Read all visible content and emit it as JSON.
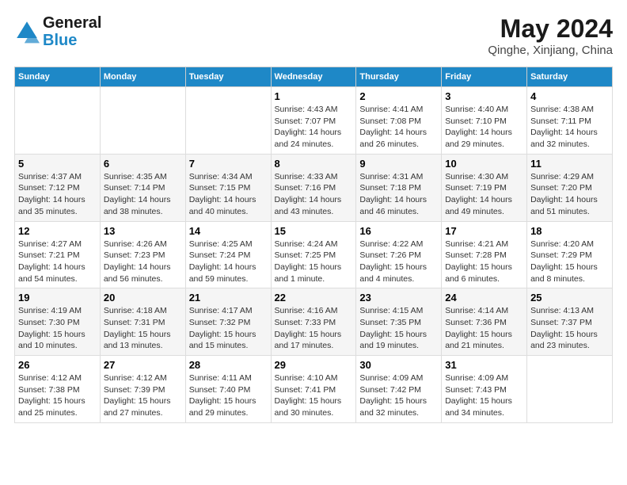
{
  "logo": {
    "line1": "General",
    "line2": "Blue",
    "icon_color": "#1e88c7"
  },
  "title": "May 2024",
  "subtitle": "Qinghe, Xinjiang, China",
  "days_of_week": [
    "Sunday",
    "Monday",
    "Tuesday",
    "Wednesday",
    "Thursday",
    "Friday",
    "Saturday"
  ],
  "weeks": [
    [
      {
        "day": "",
        "info": ""
      },
      {
        "day": "",
        "info": ""
      },
      {
        "day": "",
        "info": ""
      },
      {
        "day": "1",
        "info": "Sunrise: 4:43 AM\nSunset: 7:07 PM\nDaylight: 14 hours\nand 24 minutes."
      },
      {
        "day": "2",
        "info": "Sunrise: 4:41 AM\nSunset: 7:08 PM\nDaylight: 14 hours\nand 26 minutes."
      },
      {
        "day": "3",
        "info": "Sunrise: 4:40 AM\nSunset: 7:10 PM\nDaylight: 14 hours\nand 29 minutes."
      },
      {
        "day": "4",
        "info": "Sunrise: 4:38 AM\nSunset: 7:11 PM\nDaylight: 14 hours\nand 32 minutes."
      }
    ],
    [
      {
        "day": "5",
        "info": "Sunrise: 4:37 AM\nSunset: 7:12 PM\nDaylight: 14 hours\nand 35 minutes."
      },
      {
        "day": "6",
        "info": "Sunrise: 4:35 AM\nSunset: 7:14 PM\nDaylight: 14 hours\nand 38 minutes."
      },
      {
        "day": "7",
        "info": "Sunrise: 4:34 AM\nSunset: 7:15 PM\nDaylight: 14 hours\nand 40 minutes."
      },
      {
        "day": "8",
        "info": "Sunrise: 4:33 AM\nSunset: 7:16 PM\nDaylight: 14 hours\nand 43 minutes."
      },
      {
        "day": "9",
        "info": "Sunrise: 4:31 AM\nSunset: 7:18 PM\nDaylight: 14 hours\nand 46 minutes."
      },
      {
        "day": "10",
        "info": "Sunrise: 4:30 AM\nSunset: 7:19 PM\nDaylight: 14 hours\nand 49 minutes."
      },
      {
        "day": "11",
        "info": "Sunrise: 4:29 AM\nSunset: 7:20 PM\nDaylight: 14 hours\nand 51 minutes."
      }
    ],
    [
      {
        "day": "12",
        "info": "Sunrise: 4:27 AM\nSunset: 7:21 PM\nDaylight: 14 hours\nand 54 minutes."
      },
      {
        "day": "13",
        "info": "Sunrise: 4:26 AM\nSunset: 7:23 PM\nDaylight: 14 hours\nand 56 minutes."
      },
      {
        "day": "14",
        "info": "Sunrise: 4:25 AM\nSunset: 7:24 PM\nDaylight: 14 hours\nand 59 minutes."
      },
      {
        "day": "15",
        "info": "Sunrise: 4:24 AM\nSunset: 7:25 PM\nDaylight: 15 hours\nand 1 minute."
      },
      {
        "day": "16",
        "info": "Sunrise: 4:22 AM\nSunset: 7:26 PM\nDaylight: 15 hours\nand 4 minutes."
      },
      {
        "day": "17",
        "info": "Sunrise: 4:21 AM\nSunset: 7:28 PM\nDaylight: 15 hours\nand 6 minutes."
      },
      {
        "day": "18",
        "info": "Sunrise: 4:20 AM\nSunset: 7:29 PM\nDaylight: 15 hours\nand 8 minutes."
      }
    ],
    [
      {
        "day": "19",
        "info": "Sunrise: 4:19 AM\nSunset: 7:30 PM\nDaylight: 15 hours\nand 10 minutes."
      },
      {
        "day": "20",
        "info": "Sunrise: 4:18 AM\nSunset: 7:31 PM\nDaylight: 15 hours\nand 13 minutes."
      },
      {
        "day": "21",
        "info": "Sunrise: 4:17 AM\nSunset: 7:32 PM\nDaylight: 15 hours\nand 15 minutes."
      },
      {
        "day": "22",
        "info": "Sunrise: 4:16 AM\nSunset: 7:33 PM\nDaylight: 15 hours\nand 17 minutes."
      },
      {
        "day": "23",
        "info": "Sunrise: 4:15 AM\nSunset: 7:35 PM\nDaylight: 15 hours\nand 19 minutes."
      },
      {
        "day": "24",
        "info": "Sunrise: 4:14 AM\nSunset: 7:36 PM\nDaylight: 15 hours\nand 21 minutes."
      },
      {
        "day": "25",
        "info": "Sunrise: 4:13 AM\nSunset: 7:37 PM\nDaylight: 15 hours\nand 23 minutes."
      }
    ],
    [
      {
        "day": "26",
        "info": "Sunrise: 4:12 AM\nSunset: 7:38 PM\nDaylight: 15 hours\nand 25 minutes."
      },
      {
        "day": "27",
        "info": "Sunrise: 4:12 AM\nSunset: 7:39 PM\nDaylight: 15 hours\nand 27 minutes."
      },
      {
        "day": "28",
        "info": "Sunrise: 4:11 AM\nSunset: 7:40 PM\nDaylight: 15 hours\nand 29 minutes."
      },
      {
        "day": "29",
        "info": "Sunrise: 4:10 AM\nSunset: 7:41 PM\nDaylight: 15 hours\nand 30 minutes."
      },
      {
        "day": "30",
        "info": "Sunrise: 4:09 AM\nSunset: 7:42 PM\nDaylight: 15 hours\nand 32 minutes."
      },
      {
        "day": "31",
        "info": "Sunrise: 4:09 AM\nSunset: 7:43 PM\nDaylight: 15 hours\nand 34 minutes."
      },
      {
        "day": "",
        "info": ""
      }
    ]
  ]
}
